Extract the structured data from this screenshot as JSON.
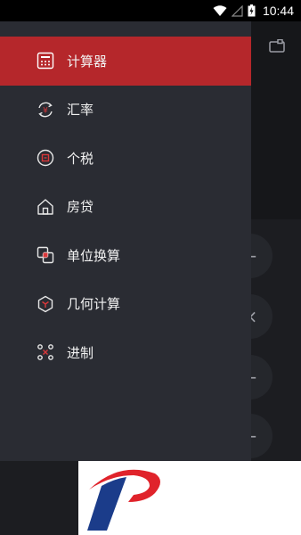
{
  "status_bar": {
    "time": "10:44",
    "icons": [
      "wifi-icon",
      "signal-icon",
      "battery-icon"
    ]
  },
  "drawer": {
    "active_color": "#b5272b",
    "items": [
      {
        "label": "计算器",
        "icon": "calculator-icon",
        "active": true
      },
      {
        "label": "汇率",
        "icon": "exchange-rate-icon",
        "active": false
      },
      {
        "label": "个税",
        "icon": "tax-icon",
        "active": false
      },
      {
        "label": "房贷",
        "icon": "house-icon",
        "active": false
      },
      {
        "label": "单位换算",
        "icon": "unit-convert-icon",
        "active": false
      },
      {
        "label": "几何计算",
        "icon": "geometry-icon",
        "active": false
      },
      {
        "label": "进制",
        "icon": "base-convert-icon",
        "active": false
      }
    ]
  },
  "background_screen": {
    "history_icon": "history-icon"
  },
  "logo": {
    "name": "brand-logo",
    "colors": [
      "#e0232b",
      "#1b3c8a"
    ]
  }
}
